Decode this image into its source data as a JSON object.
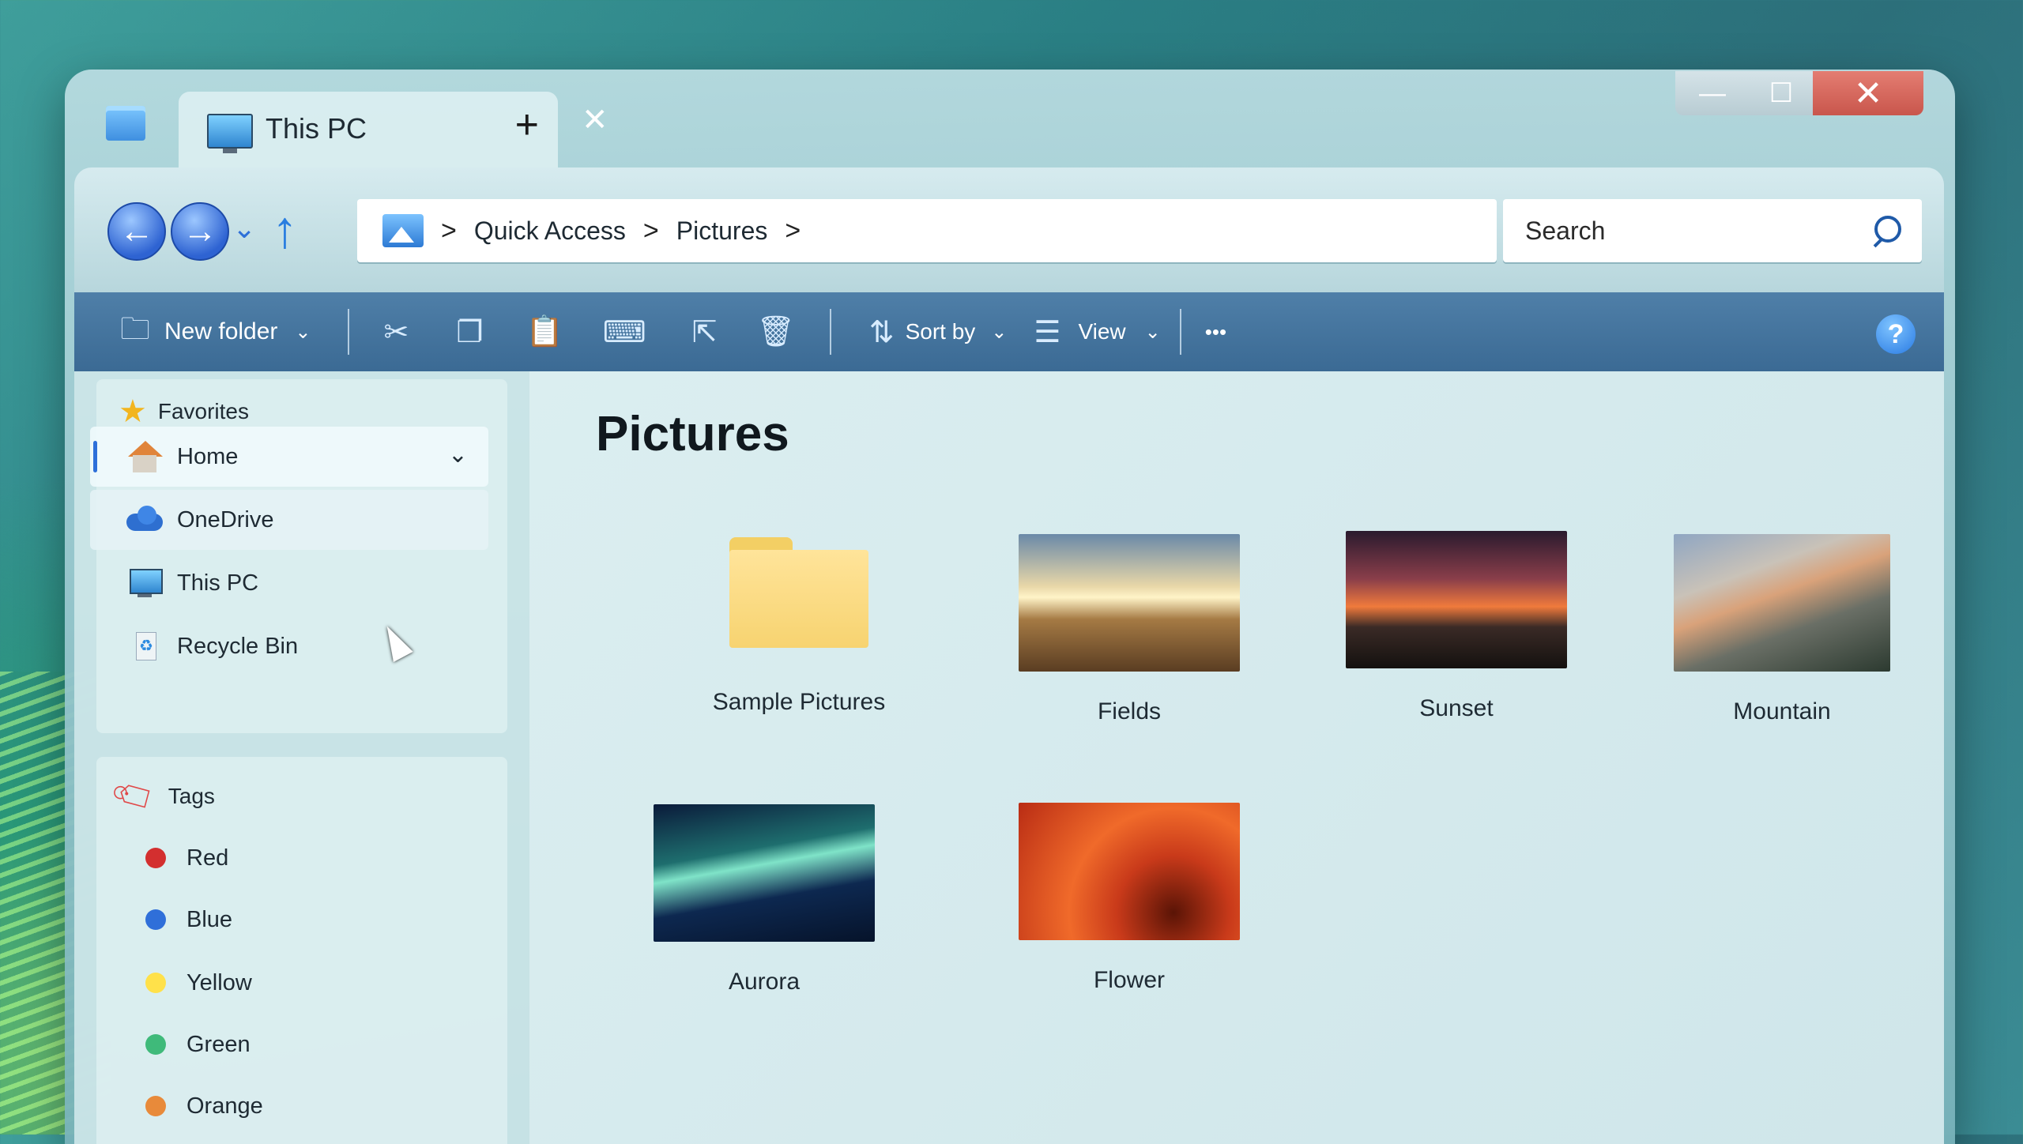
{
  "tab": {
    "title": "This PC",
    "add_label": "+",
    "close_label": "✕"
  },
  "window_controls": {
    "minimize": "—",
    "maximize": "☐",
    "close": "✕"
  },
  "nav": {
    "back": "←",
    "forward": "→",
    "history": "⌄",
    "up": "↑",
    "breadcrumb": [
      "Quick Access",
      "Pictures"
    ],
    "separator": ">",
    "search_placeholder": "Search"
  },
  "toolbar": {
    "new_folder": "New folder",
    "sort_by": "Sort by",
    "view": "View",
    "more": "•••",
    "help": "?"
  },
  "sidebar": {
    "favorites": {
      "title": "Favorites",
      "items": [
        {
          "label": "Home",
          "icon": "home-icon"
        },
        {
          "label": "OneDrive",
          "icon": "cloud-icon"
        },
        {
          "label": "This PC",
          "icon": "monitor-icon"
        },
        {
          "label": "Recycle Bin",
          "icon": "recycle-bin-icon"
        }
      ]
    },
    "tags": {
      "title": "Tags",
      "items": [
        {
          "label": "Red",
          "color": "#d32f2f"
        },
        {
          "label": "Blue",
          "color": "#2f6fd9"
        },
        {
          "label": "Yellow",
          "color": "#ffe14a"
        },
        {
          "label": "Green",
          "color": "#3fba7a"
        },
        {
          "label": "Orange",
          "color": "#e88a3a"
        }
      ]
    }
  },
  "content": {
    "title": "Pictures",
    "items": [
      {
        "label": "Sample Pictures",
        "kind": "folder"
      },
      {
        "label": "Fields",
        "kind": "image"
      },
      {
        "label": "Sunset",
        "kind": "image"
      },
      {
        "label": "Mountain",
        "kind": "image"
      },
      {
        "label": "Aurora",
        "kind": "image"
      },
      {
        "label": "Flower",
        "kind": "image"
      }
    ]
  }
}
